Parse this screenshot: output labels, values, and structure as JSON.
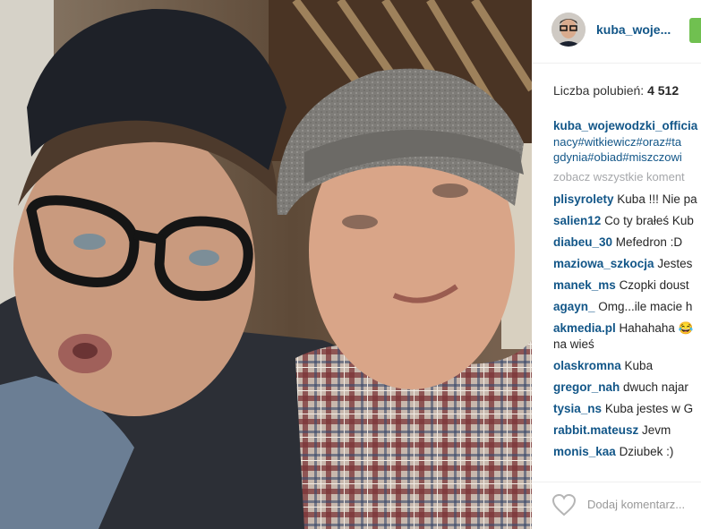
{
  "post": {
    "username": "kuba_woje...",
    "likes_label": "Liczba polubień:",
    "likes_count": "4 512",
    "caption_user": "kuba_wojewodzki_officia",
    "caption_lines": [
      "nacy#witkiewicz#oraz#ta",
      "gdynia#obiad#miszczowi"
    ],
    "view_all": "zobacz wszystkie koment",
    "comments": [
      {
        "user": "plisyrolety",
        "text": "Kuba !!! Nie pa"
      },
      {
        "user": "salien12",
        "text": "Co ty brałeś Kub"
      },
      {
        "user": "diabeu_30",
        "text": "Mefedron :D"
      },
      {
        "user": "maziowa_szkocja",
        "text": "Jestes"
      },
      {
        "user": "manek_ms",
        "text": "Czopki doust"
      },
      {
        "user": "agayn_",
        "text": "Omg...ile macie h"
      },
      {
        "user": "akmedia.pl",
        "text": "Hahahaha 😂",
        "text2": "na wieś"
      },
      {
        "user": "olaskromna",
        "text": "Kuba"
      },
      {
        "user": "gregor_nah",
        "text": "dwuch najar"
      },
      {
        "user": "tysia_ns",
        "text": "Kuba jestes w G"
      },
      {
        "user": "rabbit.mateusz",
        "text": "Jevm"
      },
      {
        "user": "monis_kaa",
        "text": "Dziubek :)"
      }
    ],
    "add_comment_placeholder": "Dodaj komentarz..."
  },
  "colors": {
    "link": "#125688",
    "follow": "#70c050",
    "muted": "#a5a7aa"
  },
  "icons": [
    "heart-icon",
    "avatar"
  ]
}
